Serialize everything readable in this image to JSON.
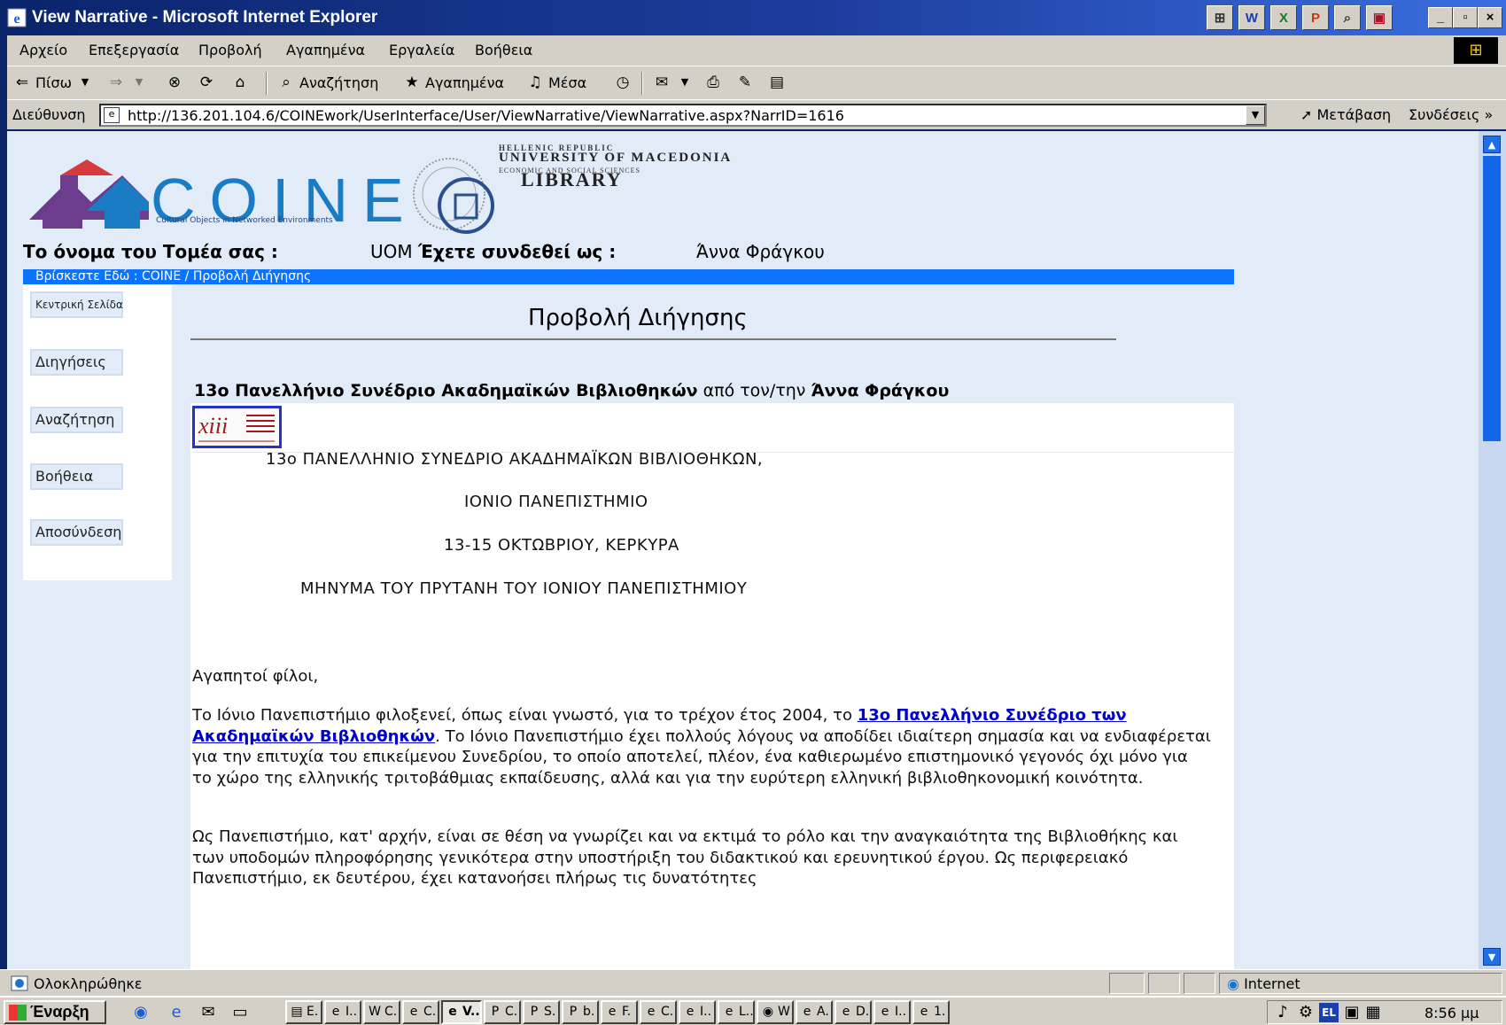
{
  "window": {
    "title": "View Narrative - Microsoft Internet Explorer",
    "controls": {
      "minimize": "_",
      "maximize": "▫",
      "close": "×"
    }
  },
  "menu": [
    "Αρχείο",
    "Επεξεργασία",
    "Προβολή",
    "Αγαπημένα",
    "Εργαλεία",
    "Βοήθεια"
  ],
  "toolbar": {
    "back": "Πίσω",
    "search": "Αναζήτηση",
    "favorites": "Αγαπημένα",
    "media": "Μέσα"
  },
  "address": {
    "label": "Διεύθυνση",
    "url": "http://136.201.104.6/COINEwork/UserInterface/User/ViewNarrative/ViewNarrative.aspx?NarrID=1616",
    "go": "Μετάβαση",
    "links": "Συνδέσεις"
  },
  "logo": {
    "word": "COINE",
    "subtitle": "Cultural Objects in Networked Environments",
    "uom_republic": "HELLENIC REPUBLIC",
    "uom_name": "UNIVERSITY OF MACEDONIA",
    "uom_faculty": "ECONOMIC AND SOCIAL SCIENCES",
    "uom_library": "LIBRARY"
  },
  "header": {
    "sector_label": "Το όνομα του Τομέα σας :",
    "sector_value": "UOM",
    "logged_label": "Έχετε συνδεθεί ως :",
    "user": "Άννα Φράγκου",
    "breadcrumb": "Βρίσκεστε Εδώ : COINE / Προβολή Διήγησης"
  },
  "sidebar": [
    "Κεντρική Σελίδα",
    "Διηγήσεις",
    "Αναζήτηση",
    "Βοήθεια",
    "Αποσύνδεση"
  ],
  "main": {
    "title": "Προβολή Διήγησης",
    "narrative_title": "13ο Πανελλήνιο Συνέδριο Ακαδημαϊκών Βιβλιοθηκών",
    "by": "από τον/την",
    "author": "Άννα Φράγκου",
    "centered_lines": [
      "13ο ΠΑΝΕΛΛΗΝΙΟ ΣΥΝΕΔΡΙΟ ΑΚΑΔΗΜΑΪΚΩΝ ΒΙΒΛΙΟΘΗΚΩΝ,",
      "ΙΟΝΙΟ ΠΑΝΕΠΙΣΤΗΜΙΟ",
      "13-15 ΟΚΤΩΒΡΙΟΥ, ΚΕΡΚΥΡΑ",
      "ΜΗΝΥΜΑ ΤΟΥ ΠΡΥΤΑΝΗ ΤΟΥ ΙΟΝΙΟΥ ΠΑΝΕΠΙΣΤΗΜΙΟΥ"
    ],
    "greeting": "Αγαπητοί φίλοι,",
    "p1_before": "Το Ιόνιο Πανεπιστήμιο φιλοξενεί, όπως είναι γνωστό, για το τρέχον έτος 2004, το ",
    "p1_link": "13ο Πανελλήνιο Συνέδριο των Ακαδημαϊκών Βιβλιοθηκών",
    "p1_after": ". Το Ιόνιο Πανεπιστήμιο έχει πολλούς λόγους να αποδίδει ιδιαίτερη σημασία και να ενδιαφέρεται για την επιτυχία του επικείμενου Συνεδρίου, το οποίο αποτελεί, πλέον, ένα καθιερωμένο επιστημονικό γεγονός όχι μόνο για το χώρο της ελληνικής τριτοβάθμιας εκπαίδευσης, αλλά και για την ευρύτερη ελληνική βιβλιοθηκονομική κοινότητα.",
    "p2": "Ως Πανεπιστήμιο, κατ' αρχήν, είναι σε θέση να γνωρίζει και να εκτιμά το ρόλο και την αναγκαιότητα της Βιβλιοθήκης και των υποδομών πληροφόρησης γενικότερα στην υποστήριξη του διδακτικού και ερευνητικού έργου. Ως περιφερειακό Πανεπιστήμιο, εκ δευτέρου, έχει κατανοήσει πλήρως τις δυνατότητες"
  },
  "status": {
    "text": "Ολοκληρώθηκε",
    "zone": "Internet"
  },
  "taskbar": {
    "start": "Έναρξη",
    "tasks": [
      "E.",
      "I..",
      "C.",
      "C.",
      "V..",
      "C.",
      "S.",
      "b.",
      "F.",
      "C.",
      "I..",
      "L..",
      "W",
      "A.",
      "D.",
      "I..",
      "1."
    ],
    "language": "EL",
    "clock": "8:56 μμ"
  },
  "colors": {
    "page_bg": "#e1ecf8",
    "breadcrumb_bg": "#0a73ff",
    "link": "#0000cc",
    "logo_blue": "#1a7cc4",
    "logo_purple": "#6b3d8c"
  }
}
